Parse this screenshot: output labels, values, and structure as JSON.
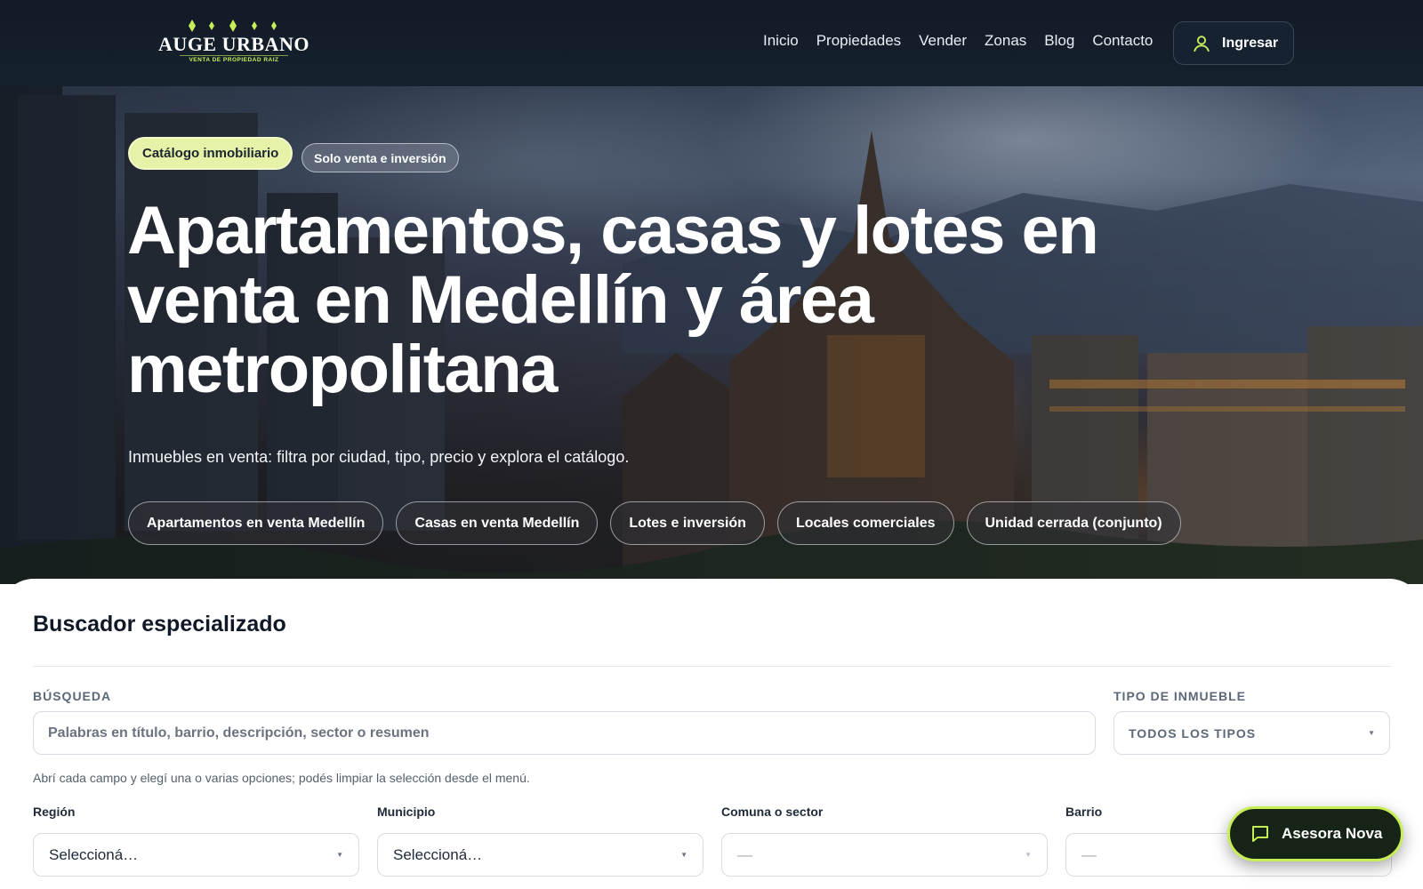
{
  "brand": {
    "name": "AUGE URBANO",
    "tagline": "VENTA DE PROPIEDAD RAIZ",
    "accent_color": "#c8ee5a",
    "header_bg": "#111b27"
  },
  "nav": {
    "items": [
      "Inicio",
      "Propiedades",
      "Vender",
      "Zonas",
      "Blog",
      "Contacto"
    ],
    "login_label": "Ingresar",
    "login_icon": "user-icon"
  },
  "hero": {
    "badge_primary": "Catálogo inmobiliario",
    "badge_secondary": "Solo venta e inversión",
    "title": "Apartamentos, casas y lotes en venta en Medellín y área metropolitana",
    "subtitle": "Inmuebles en venta: filtra por ciudad, tipo, precio y explora el catálogo.",
    "chips": [
      "Apartamentos en venta Medellín",
      "Casas en venta Medellín",
      "Lotes e inversión",
      "Locales comerciales",
      "Unidad cerrada (conjunto)"
    ]
  },
  "search": {
    "title": "Buscador especializado",
    "query_label": "BÚSQUEDA",
    "query_placeholder": "Palabras en título, barrio, descripción, sector o resumen",
    "query_value": "",
    "type_label": "TIPO DE INMUEBLE",
    "type_value": "TODOS LOS TIPOS",
    "help_text": "Abrí cada campo y elegí una o varias opciones; podés limpiar la selección desde el menú.",
    "fields": [
      {
        "label": "Región",
        "value": "Seleccioná…",
        "enabled": true
      },
      {
        "label": "Municipio",
        "value": "Seleccioná…",
        "enabled": true
      },
      {
        "label": "Comuna o sector",
        "value": "—",
        "enabled": false
      },
      {
        "label": "Barrio",
        "value": "—",
        "enabled": false
      }
    ]
  },
  "assistant": {
    "label": "Asesora Nova",
    "icon": "chat-icon",
    "border_color": "#c7ef55"
  }
}
